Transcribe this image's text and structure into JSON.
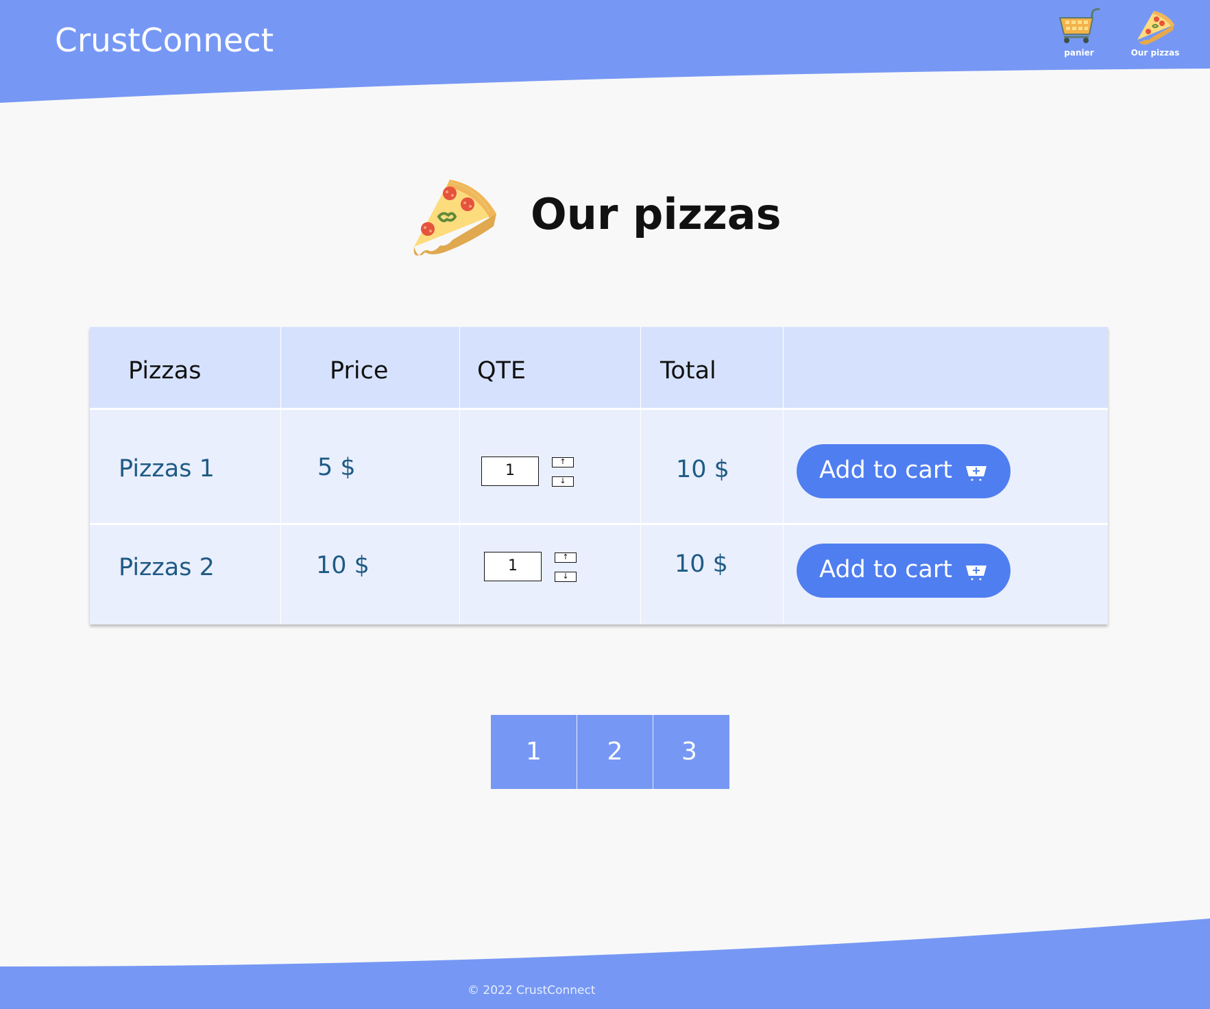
{
  "header": {
    "brand": "CrustConnect",
    "nav": [
      {
        "label": "panier",
        "icon": "shopping-cart-icon"
      },
      {
        "label": "Our pizzas",
        "icon": "pizza-slice-icon"
      }
    ]
  },
  "page": {
    "title": "Our pizzas",
    "title_icon": "pizza-slice-icon"
  },
  "table": {
    "columns": [
      "Pizzas",
      "Price",
      "QTE",
      "Total",
      ""
    ],
    "rows": [
      {
        "name": "Pizzas 1",
        "price": "5 $",
        "qty": "1",
        "total": "10 $",
        "action": "Add to cart"
      },
      {
        "name": "Pizzas 2",
        "price": "10 $",
        "qty": "1",
        "total": "10 $",
        "action": "Add to cart"
      }
    ]
  },
  "pagination": {
    "pages": [
      "1",
      "2",
      "3"
    ]
  },
  "footer": {
    "copyright": "© 2022 CrustConnect"
  },
  "colors": {
    "header_bg": "#7698f4",
    "button_bg": "#4f7ef0",
    "table_header_bg": "#d6e2fd",
    "table_row_bg": "#e9effd",
    "cell_text": "#1f5a84",
    "page_bg": "#f8f8f8"
  }
}
